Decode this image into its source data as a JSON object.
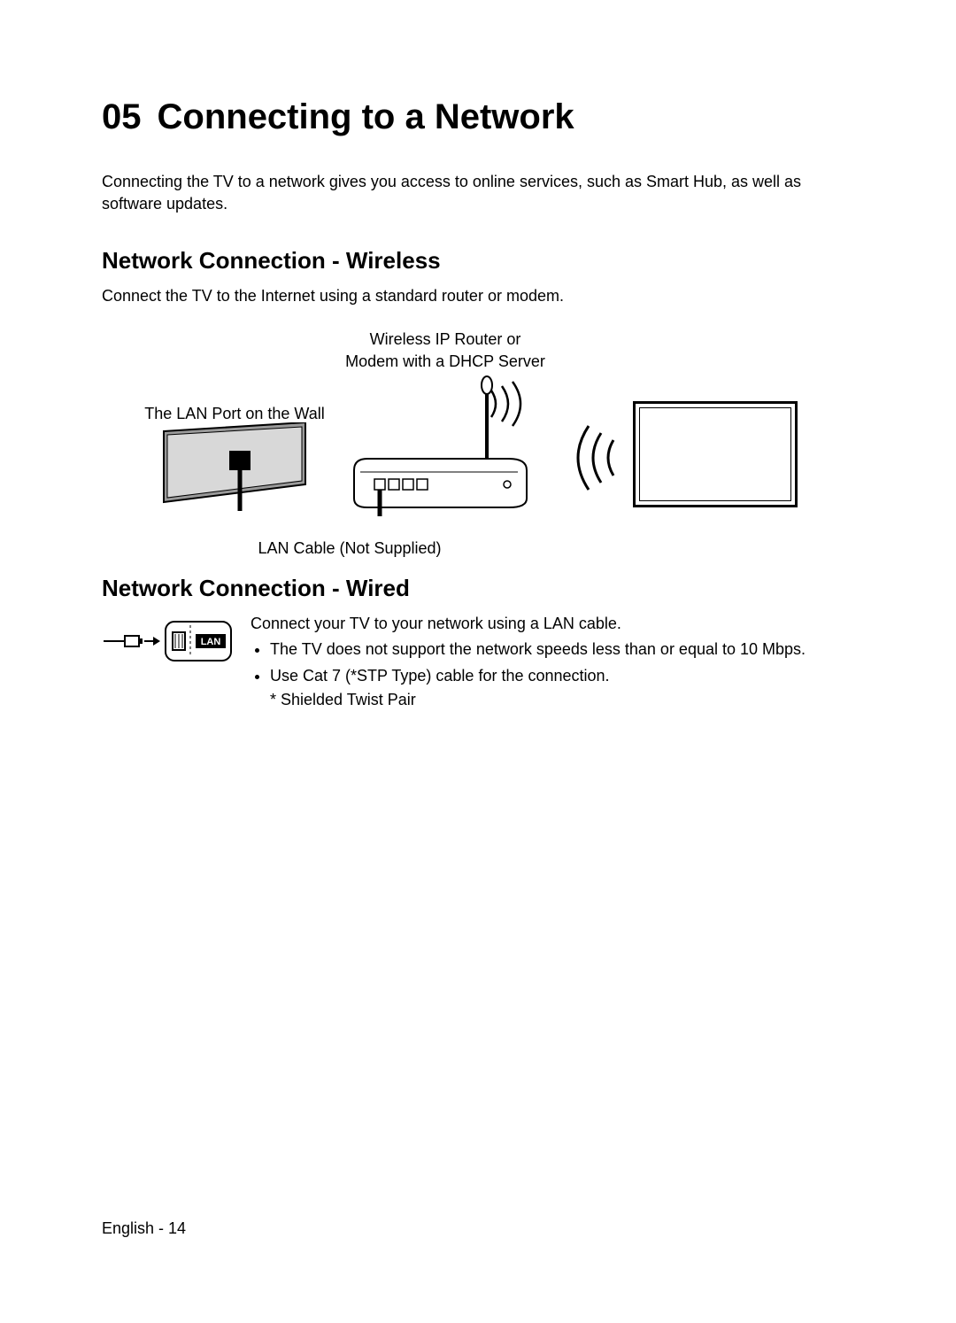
{
  "chapter_number": "05",
  "chapter_title": "Connecting to a Network",
  "intro": "Connecting the TV to a network gives you access to online services, such as Smart Hub, as well as software updates.",
  "wireless": {
    "title": "Network Connection - Wireless",
    "intro": "Connect the TV to the Internet using a standard router or modem.",
    "diagram": {
      "router_label": "Wireless IP Router or\nModem with a DHCP Server",
      "wall_label": "The LAN Port on the Wall",
      "cable_label": "LAN Cable (Not Supplied)"
    }
  },
  "wired": {
    "title": "Network Connection - Wired",
    "intro": "Connect your TV to your network using a LAN cable.",
    "bullet1": "The TV does not support the network speeds less than or equal to 10 Mbps.",
    "bullet2": "Use Cat 7 (*STP Type) cable for the connection.",
    "footnote": "* Shielded Twist Pair",
    "port_label": "LAN"
  },
  "footer": {
    "language": "English",
    "separator": " - ",
    "page_number": "14"
  }
}
